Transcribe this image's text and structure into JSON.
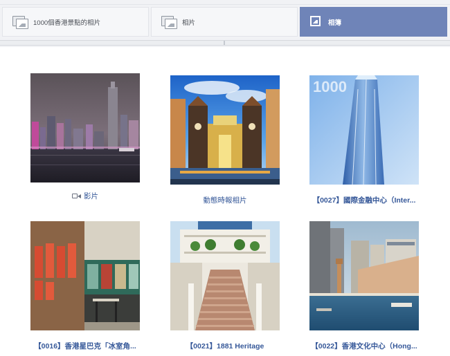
{
  "tabs": [
    {
      "label": "1000個香港景點的相片",
      "icon": "photos-icon",
      "active": false
    },
    {
      "label": "相片",
      "icon": "photos-icon",
      "active": false
    },
    {
      "label": "相簿",
      "icon": "album-icon",
      "active": true
    }
  ],
  "albums": [
    {
      "caption": "影片",
      "caption_icon": "video-camera-icon",
      "image": "night harbour skyline photo"
    },
    {
      "caption": "動態時報相片",
      "image": "colourful illuminated building photo"
    },
    {
      "caption": "【0027】國際金融中心（Inter...",
      "image": "glass skyscraper photo",
      "watermark": "1000"
    },
    {
      "caption": "【0016】香港星巴克「冰室角...",
      "image": "cafe interior photo"
    },
    {
      "caption": "【0021】1881 Heritage",
      "image": "colonial building staircase photo"
    },
    {
      "caption": "【0022】香港文化中心（Hong...",
      "image": "harbour waterfront photo"
    }
  ],
  "colors": {
    "active_tab": "#6f84b8",
    "link": "#365899",
    "tab_bg": "#f6f7f9"
  }
}
